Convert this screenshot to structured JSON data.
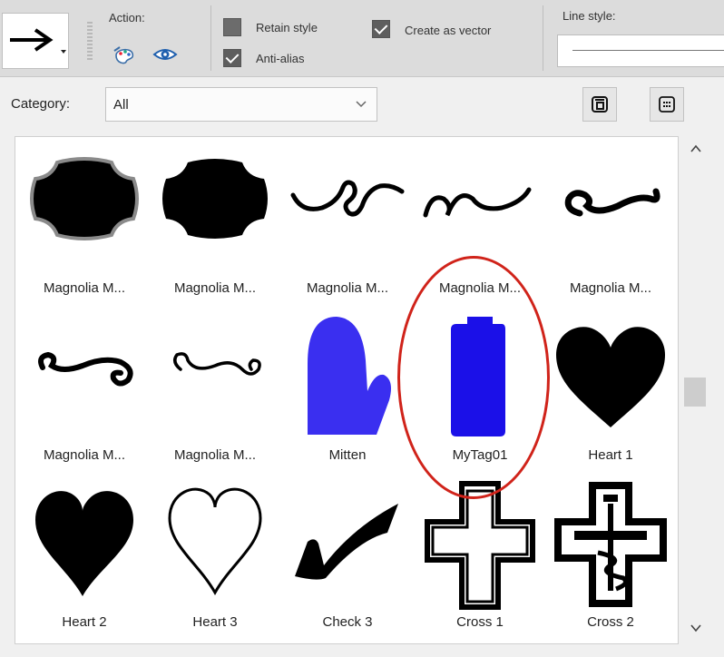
{
  "toolbar": {
    "actions_label": "Action:",
    "retain_style_label": "Retain style",
    "retain_style_checked": false,
    "anti_alias_label": "Anti-alias",
    "anti_alias_checked": true,
    "create_vector_label": "Create as vector",
    "create_vector_checked": true,
    "line_style_label": "Line style:"
  },
  "category": {
    "label": "Category:",
    "value": "All"
  },
  "shapes": [
    {
      "label": "Magnolia M...",
      "icon": "magnolia-frame-outline-icon"
    },
    {
      "label": "Magnolia M...",
      "icon": "magnolia-frame-solid-icon"
    },
    {
      "label": "Magnolia M...",
      "icon": "magnolia-flourish-loops-icon"
    },
    {
      "label": "Magnolia M...",
      "icon": "magnolia-flourish-wave-icon"
    },
    {
      "label": "Magnolia M...",
      "icon": "magnolia-flourish-swirl-icon"
    },
    {
      "label": "Magnolia M...",
      "icon": "magnolia-scroll-thick-icon"
    },
    {
      "label": "Magnolia M...",
      "icon": "magnolia-scroll-thin-icon"
    },
    {
      "label": "Mitten",
      "icon": "mitten-icon"
    },
    {
      "label": "MyTag01",
      "icon": "tag-icon"
    },
    {
      "label": "Heart 1",
      "icon": "heart-solid-icon"
    },
    {
      "label": "Heart 2",
      "icon": "heart-pointed-icon"
    },
    {
      "label": "Heart 3",
      "icon": "heart-outline-icon"
    },
    {
      "label": "Check 3",
      "icon": "checkmark-icon"
    },
    {
      "label": "Cross 1",
      "icon": "cross-outline-icon"
    },
    {
      "label": "Cross 2",
      "icon": "pharmacy-cross-icon"
    }
  ],
  "colors": {
    "shape_fill": "#000000",
    "custom_shape_fill": "#2b1fe6",
    "highlight": "#d0231a"
  }
}
